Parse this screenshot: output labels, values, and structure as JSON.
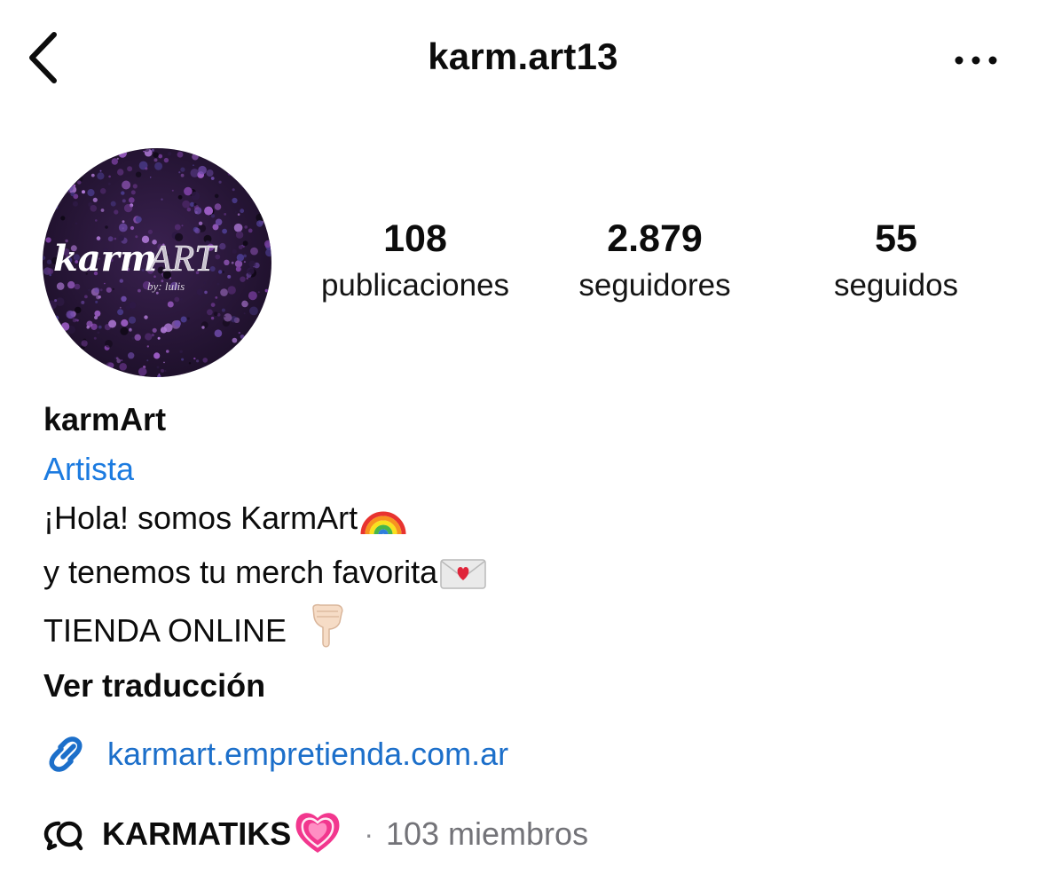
{
  "header": {
    "username": "karm.art13"
  },
  "avatar": {
    "logo_text_main": "karm",
    "logo_text_accent": "ART",
    "logo_byline": "by: lulis"
  },
  "stats": {
    "posts": {
      "value": "108",
      "label": "publicaciones"
    },
    "followers": {
      "value": "2.879",
      "label": "seguidores"
    },
    "following": {
      "value": "55",
      "label": "seguidos"
    }
  },
  "bio": {
    "display_name": "karmArt",
    "category": "Artista",
    "lines": [
      "¡Hola! somos KarmArt",
      "y tenemos tu merch favorita",
      "TIENDA ONLINE"
    ],
    "line_emojis": [
      "rainbow-emoji",
      "love-letter-emoji",
      "pointing-down-emoji"
    ],
    "see_translation": "Ver traducción"
  },
  "link": {
    "icon": "link-icon",
    "url_text": "karmart.empretienda.com.ar"
  },
  "channel": {
    "icon": "broadcast-channel-icon",
    "name": "KARMATIKS",
    "emoji": "growing-heart-emoji",
    "separator": "·",
    "members": "103 miembros"
  },
  "colors": {
    "accent_link": "#1c6fca",
    "category_blue": "#1c7be0",
    "secondary_text": "#737378",
    "avatar_bg": "#2a1638"
  }
}
